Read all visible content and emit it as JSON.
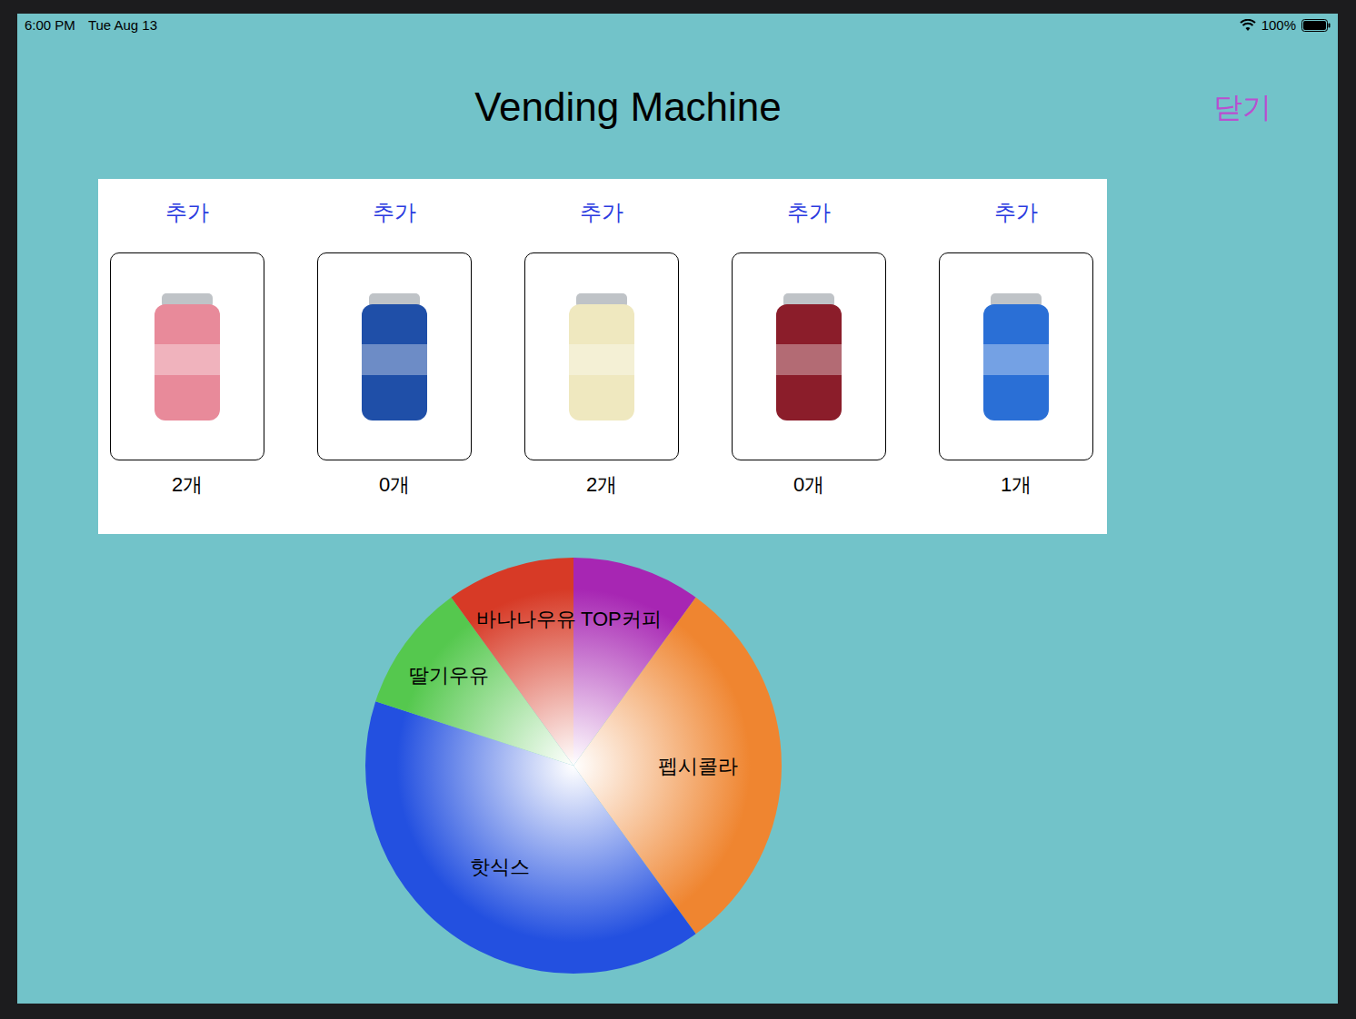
{
  "status_bar": {
    "time": "6:00 PM",
    "date": "Tue Aug 13",
    "battery": "100%"
  },
  "header": {
    "title": "Vending Machine",
    "close_button": "닫기"
  },
  "products": [
    {
      "add_label": "추가",
      "count": "2개",
      "color": "#e88a9a"
    },
    {
      "add_label": "추가",
      "count": "0개",
      "color": "#1f4fa8"
    },
    {
      "add_label": "추가",
      "count": "2개",
      "color": "#efe8bf"
    },
    {
      "add_label": "추가",
      "count": "0개",
      "color": "#8b1d2a"
    },
    {
      "add_label": "추가",
      "count": "1개",
      "color": "#2a6fd6"
    }
  ],
  "chart": {
    "slices": [
      {
        "label": "TOP커피",
        "value": 1,
        "color": "#a726b3"
      },
      {
        "label": "펩시콜라",
        "value": 3,
        "color": "#ef8530"
      },
      {
        "label": "핫식스",
        "value": 4,
        "color": "#2350e0"
      },
      {
        "label": "딸기우유",
        "value": 1,
        "color": "#55c84e"
      },
      {
        "label": "바나나우유",
        "value": 1,
        "color": "#d73a26"
      }
    ]
  }
}
